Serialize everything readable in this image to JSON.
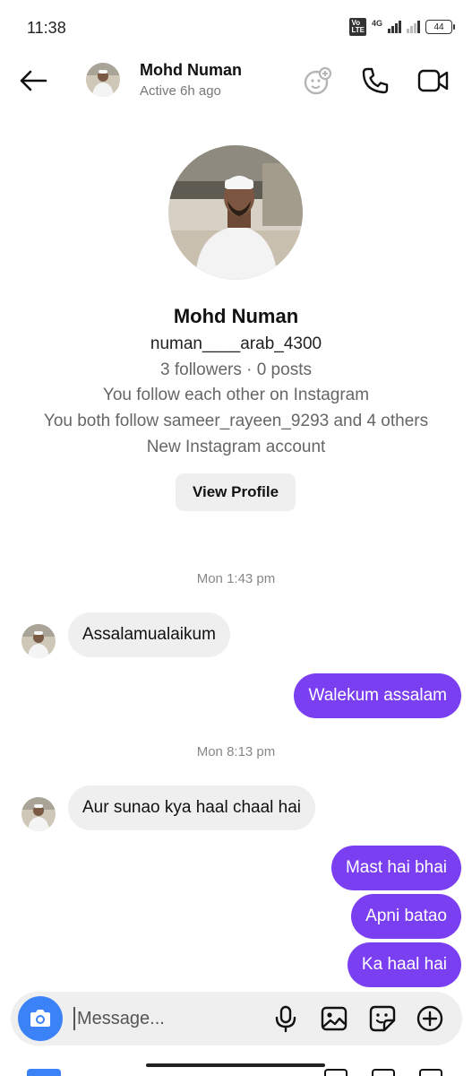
{
  "status_bar": {
    "time": "11:38",
    "volte": "Vo LTE",
    "network": "4G",
    "battery": "44"
  },
  "header": {
    "name": "Mohd Numan",
    "status": "Active 6h ago",
    "icons": [
      "back-arrow-icon",
      "effects-icon",
      "phone-icon",
      "video-icon"
    ]
  },
  "profile": {
    "name": "Mohd Numan",
    "username": "numan____arab_4300",
    "stats": "3 followers · 0 posts",
    "follow_info": "You follow each other on Instagram",
    "mutual": "You both follow sameer_rayeen_9293 and 4 others",
    "account_note": "New Instagram account",
    "view_profile_label": "View Profile"
  },
  "chat": {
    "timestamp1": "Mon 1:43 pm",
    "msg1": "Assalamualaikum",
    "msg2": "Walekum assalam",
    "timestamp2": "Mon 8:13 pm",
    "msg3": "Aur sunao kya haal chaal hai",
    "msg4": "Mast hai bhai",
    "msg5": "Apni batao",
    "msg6": "Ka haal hai"
  },
  "composer": {
    "placeholder": "Message...",
    "icons": [
      "camera-icon",
      "microphone-icon",
      "gallery-icon",
      "sticker-icon",
      "plus-icon"
    ]
  },
  "colors": {
    "outgoing_bubble": "#7b3ff2",
    "incoming_bubble": "#efefef",
    "camera_button": "#3b82f6"
  }
}
